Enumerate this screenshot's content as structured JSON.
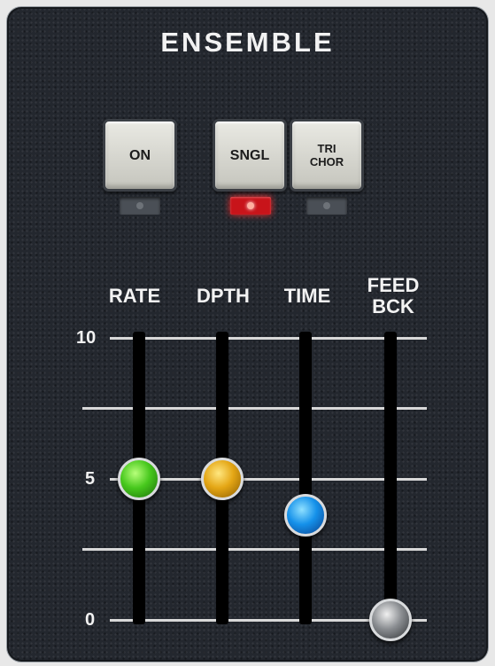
{
  "title": "ENSEMBLE",
  "buttons": [
    {
      "label": "ON",
      "led_on": false
    },
    {
      "label": "SNGL",
      "led_on": true
    },
    {
      "label_line1": "TRI",
      "label_line2": "CHOR",
      "led_on": false
    }
  ],
  "faders": [
    {
      "label": "RATE",
      "value": 5,
      "knob_color": "green"
    },
    {
      "label": "DPTH",
      "value": 5,
      "knob_color": "yellow"
    },
    {
      "label_line1": "FEED",
      "label_line2": "BCK",
      "value": 0,
      "knob_color": "grey"
    },
    {
      "label": "TIME",
      "value": 3.7,
      "knob_color": "blue"
    }
  ],
  "scale": {
    "max_label": "10",
    "mid_label": "5",
    "min_label": "0",
    "min": 0,
    "max": 10
  },
  "colors": {
    "panel": "#23272e",
    "text": "#f2f2f2",
    "led_active": "#c8141a"
  }
}
